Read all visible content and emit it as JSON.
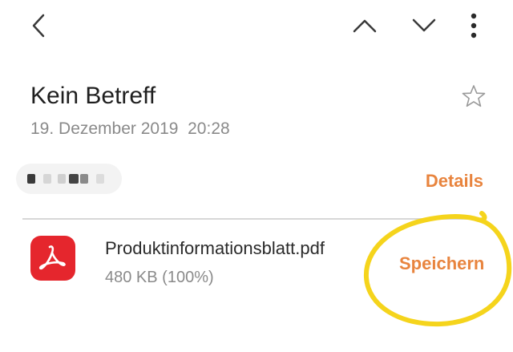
{
  "toolbar": {
    "back_icon": "chevron-left-icon",
    "prev_icon": "chevron-up-icon",
    "next_icon": "chevron-down-icon",
    "more_icon": "more-vertical-icon"
  },
  "email": {
    "subject": "Kein Betreff",
    "date": "19. Dezember 2019",
    "time": "20:28",
    "star_icon": "star-outline-icon",
    "details_label": "Details"
  },
  "attachment": {
    "icon": "pdf-icon",
    "filename": "Produktinformationsblatt.pdf",
    "size": "480 KB (100%)",
    "save_label": "Speichern"
  },
  "colors": {
    "accent": "#e8843e",
    "pdf_red": "#e5262d",
    "highlight_circle": "#f5d41c"
  }
}
